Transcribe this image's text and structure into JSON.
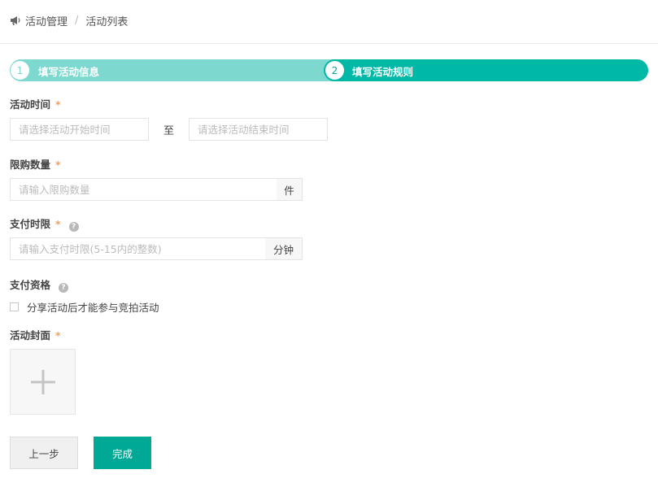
{
  "breadcrumb": {
    "icon": "megaphone-icon",
    "parent": "活动管理",
    "separator": "/",
    "current": "活动列表"
  },
  "steps": [
    {
      "number": "1",
      "label": "填写活动信息",
      "color": "#7dd9cf"
    },
    {
      "number": "2",
      "label": "填写活动规则",
      "color": "#00b8a6"
    }
  ],
  "form": {
    "time": {
      "label": "活动时间",
      "required_mark": "*",
      "start_placeholder": "请选择活动开始时间",
      "range_separator": "至",
      "end_placeholder": "请选择活动结束时间"
    },
    "quantity": {
      "label": "限购数量",
      "required_mark": "*",
      "placeholder": "请输入限购数量",
      "unit": "件"
    },
    "pay_limit": {
      "label": "支付时限",
      "required_mark": "*",
      "help_icon": "question-circle-icon",
      "placeholder": "请输入支付时限(5-15内的整数)",
      "unit": "分钟"
    },
    "pay_eligibility": {
      "label": "支付资格",
      "help_icon": "question-circle-icon",
      "checkbox_label": "分享活动后才能参与竞拍活动",
      "checked": false
    },
    "cover": {
      "label": "活动封面",
      "required_mark": "*",
      "upload_icon": "plus-icon"
    }
  },
  "buttons": {
    "prev": "上一步",
    "done": "完成"
  },
  "colors": {
    "accent": "#00a896",
    "step_done": "#7dd9cf",
    "step_active": "#00b8a6",
    "required": "#f5a05a"
  }
}
